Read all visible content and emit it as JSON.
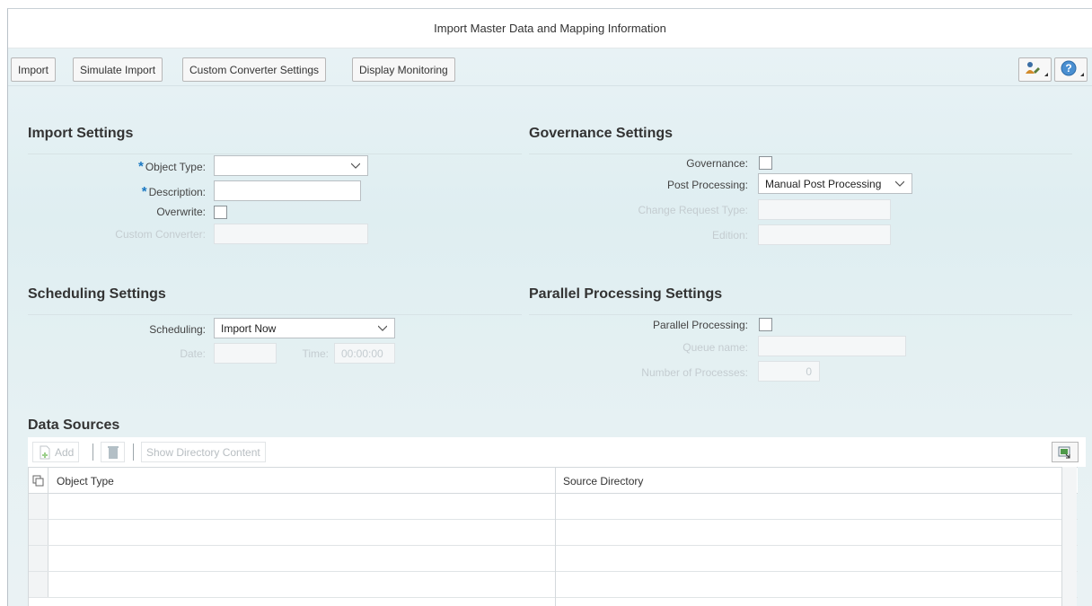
{
  "window": {
    "title": "Import Master Data and Mapping Information"
  },
  "toolbar": {
    "buttons": [
      "Import",
      "Simulate Import",
      "Custom Converter Settings",
      "Display Monitoring"
    ],
    "icons": [
      "user-settings-icon",
      "help-icon"
    ]
  },
  "import_settings": {
    "title": "Import Settings",
    "object_type_label": "Object Type:",
    "object_type_value": "",
    "description_label": "Description:",
    "description_value": "",
    "overwrite_label": "Overwrite:",
    "custom_converter_label": "Custom Converter:"
  },
  "governance_settings": {
    "title": "Governance Settings",
    "governance_label": "Governance:",
    "post_processing_label": "Post Processing:",
    "post_processing_value": "Manual Post Processing",
    "change_request_type_label": "Change Request Type:",
    "edition_label": "Edition:"
  },
  "scheduling_settings": {
    "title": "Scheduling Settings",
    "scheduling_label": "Scheduling:",
    "scheduling_value": "Import Now",
    "date_label": "Date:",
    "time_label": "Time:",
    "time_value": "00:00:00"
  },
  "parallel_settings": {
    "title": "Parallel Processing Settings",
    "parallel_label": "Parallel Processing:",
    "queue_label": "Queue name:",
    "processes_label": "Number of Processes:",
    "processes_value": "0"
  },
  "data_sources": {
    "title": "Data Sources",
    "add_label": "Add",
    "show_dir_label": "Show Directory Content",
    "columns": [
      "Object Type",
      "Source Directory"
    ],
    "rows": [
      [
        "",
        ""
      ],
      [
        "",
        ""
      ],
      [
        "",
        ""
      ],
      [
        "",
        ""
      ]
    ]
  },
  "colors": {
    "required_marker": "#1a78c2",
    "background": "#e3f0f3"
  }
}
